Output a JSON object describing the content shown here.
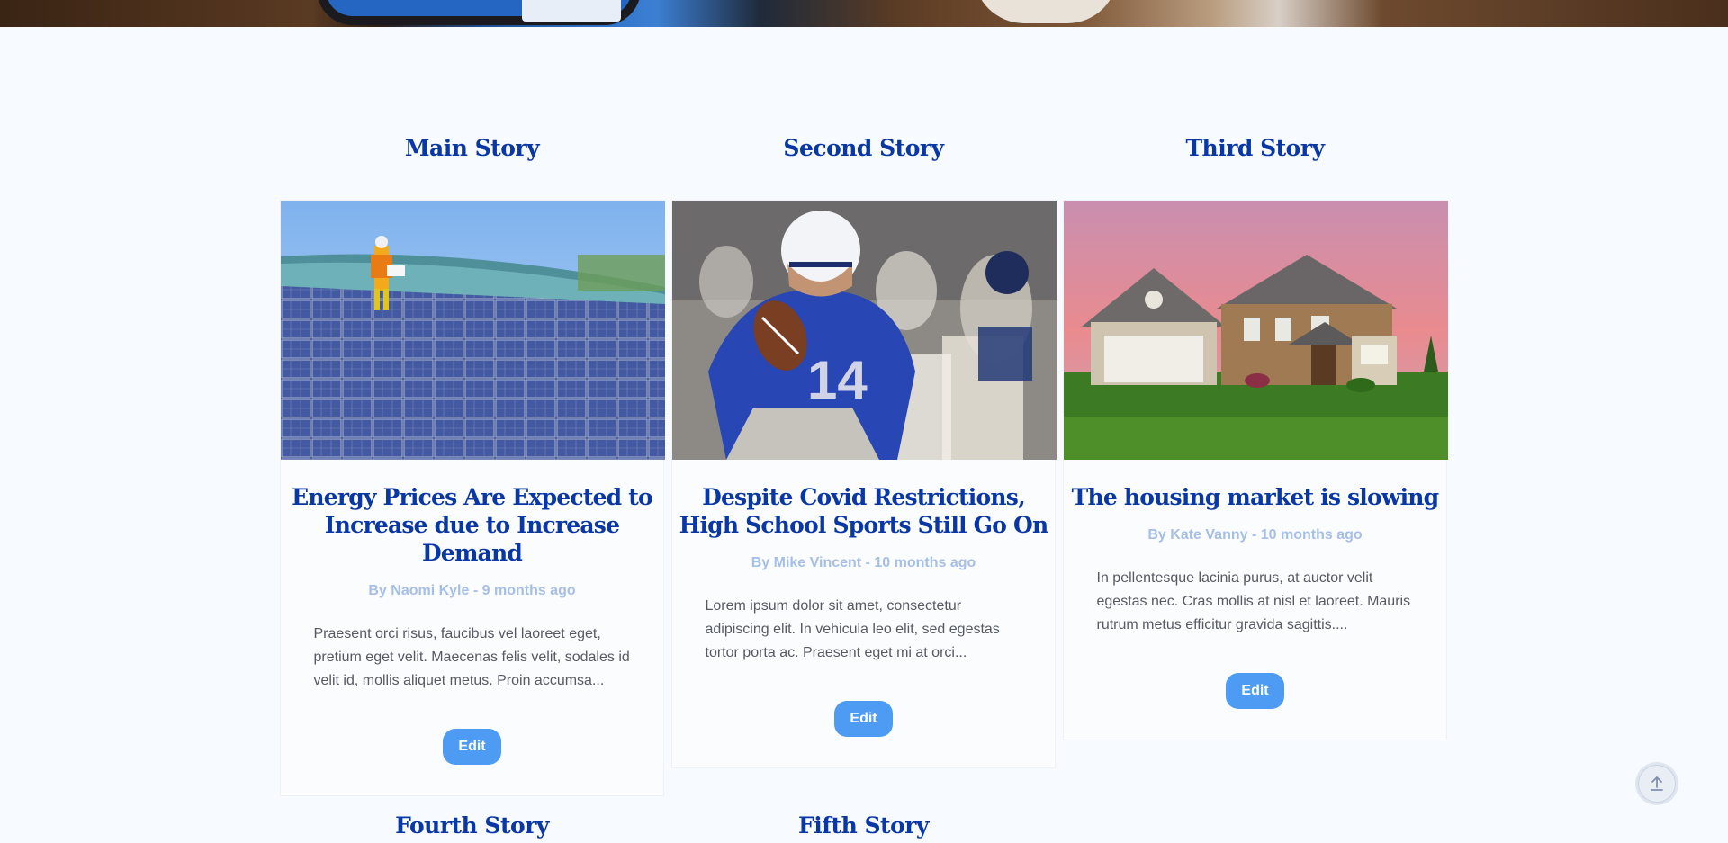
{
  "stories": [
    {
      "column_title": "Main Story",
      "title": "Energy Prices Are Expected to Increase due to Increase Demand",
      "byline": "By Naomi Kyle - 9 months ago",
      "excerpt": "Praesent orci risus, faucibus vel laoreet eget, pretium eget velit. Maecenas felis velit, sodales id velit id, mollis aliquet metus. Proin accumsa...",
      "edit_label": "Edit",
      "image_icon": "solar-panels-photo"
    },
    {
      "column_title": "Second Story",
      "title": "Despite Covid Restrictions, High School Sports Still Go On",
      "byline": "By Mike Vincent - 10 months ago",
      "excerpt": "Lorem ipsum dolor sit amet, consectetur adipiscing elit. In vehicula leo elit, sed egestas tortor porta ac. Praesent eget mi at orci...",
      "edit_label": "Edit",
      "image_icon": "football-player-photo"
    },
    {
      "column_title": "Third Story",
      "title": "The housing market is slowing",
      "byline": "By Kate Vanny - 10 months ago",
      "excerpt": "In pellentesque lacinia purus, at auctor velit egestas nec. Cras mollis at nisl et laoreet. Mauris rutrum metus efficitur gravida sagittis....",
      "edit_label": "Edit",
      "image_icon": "house-photo"
    }
  ],
  "lower_titles": [
    "Fourth Story",
    "Fifth Story"
  ],
  "scroll_top_icon": "arrow-up-icon",
  "colors": {
    "title_blue": "#0a37a6",
    "byline": "#a6bfe8",
    "button": "#4d9bf3",
    "background": "#f7fafe"
  }
}
